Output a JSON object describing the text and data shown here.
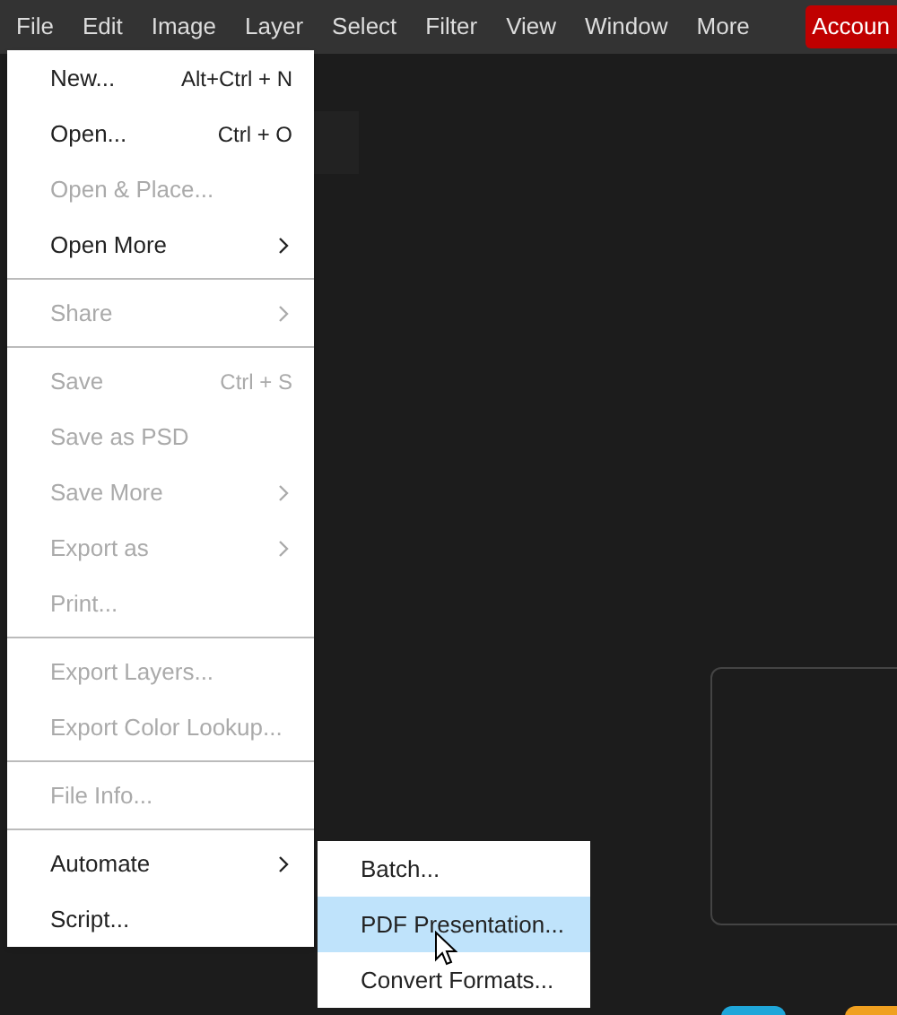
{
  "menubar": {
    "items": [
      {
        "label": "File"
      },
      {
        "label": "Edit"
      },
      {
        "label": "Image"
      },
      {
        "label": "Layer"
      },
      {
        "label": "Select"
      },
      {
        "label": "Filter"
      },
      {
        "label": "View"
      },
      {
        "label": "Window"
      },
      {
        "label": "More"
      }
    ],
    "account_button": "Accoun"
  },
  "file_menu": {
    "groups": [
      [
        {
          "label": "New...",
          "shortcut": "Alt+Ctrl + N",
          "disabled": false,
          "submenu": false
        },
        {
          "label": "Open...",
          "shortcut": "Ctrl + O",
          "disabled": false,
          "submenu": false
        },
        {
          "label": "Open & Place...",
          "disabled": true,
          "submenu": false
        },
        {
          "label": "Open More",
          "disabled": false,
          "submenu": true
        }
      ],
      [
        {
          "label": "Share",
          "disabled": true,
          "submenu": true
        }
      ],
      [
        {
          "label": "Save",
          "shortcut": "Ctrl + S",
          "disabled": true,
          "submenu": false
        },
        {
          "label": "Save as PSD",
          "disabled": true,
          "submenu": false
        },
        {
          "label": "Save More",
          "disabled": true,
          "submenu": true
        },
        {
          "label": "Export as",
          "disabled": true,
          "submenu": true
        },
        {
          "label": "Print...",
          "disabled": true,
          "submenu": false
        }
      ],
      [
        {
          "label": "Export Layers...",
          "disabled": true,
          "submenu": false
        },
        {
          "label": "Export Color Lookup...",
          "disabled": true,
          "submenu": false
        }
      ],
      [
        {
          "label": "File Info...",
          "disabled": true,
          "submenu": false
        }
      ],
      [
        {
          "label": "Automate",
          "disabled": false,
          "submenu": true
        },
        {
          "label": "Script...",
          "disabled": false,
          "submenu": false
        }
      ]
    ]
  },
  "automate_submenu": {
    "items": [
      {
        "label": "Batch...",
        "selected": false
      },
      {
        "label": "PDF Presentation...",
        "selected": true
      },
      {
        "label": "Convert Formats...",
        "selected": false
      }
    ]
  }
}
